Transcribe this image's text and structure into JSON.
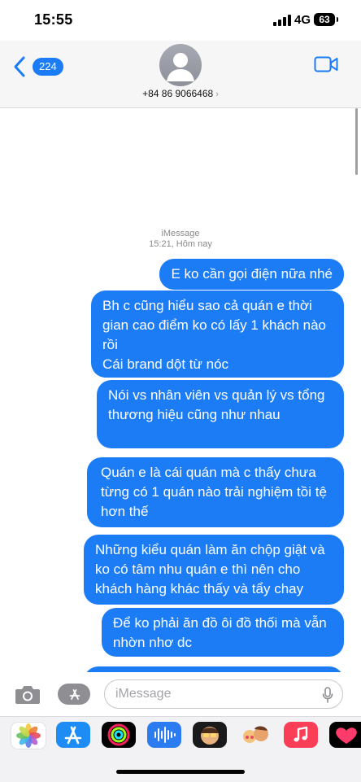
{
  "status_bar": {
    "time": "15:55",
    "network": "4G",
    "battery": "63"
  },
  "header": {
    "back_count": "224",
    "contact": "+84 86 9066468"
  },
  "thread": {
    "service": "iMessage",
    "timestamp": "15:21, Hôm nay",
    "messages": [
      "E ko cần gọi điện nữa nhé",
      "Bh c cũng hiểu sao cả quán e thời gian cao điểm ko có lấy 1 khách nào rồi\nCái brand dột từ nóc",
      "Nói vs nhân viên vs quản lý vs tổng thương hiệu cũng như nhau",
      "Quán e là cái quán mà c thấy chưa từng có 1 quán nào trải nghiệm tồi tệ hơn thế",
      "Những kiểu quán làm ăn chộp giật và ko có tâm nhu quán e thì nên cho khách hàng khác thấy và tẩy chay",
      "Để ko phải ăn đồ ôi đồ thối mà vẫn nhờn nhơ dc"
    ]
  },
  "input": {
    "placeholder": "iMessage",
    "value": ""
  },
  "app_drawer": {
    "apps": [
      "photos-app",
      "app-store-app",
      "fitness-app",
      "audio-message-app",
      "memoji-app",
      "memoji-stickers-app",
      "music-app",
      "digital-touch-app"
    ]
  },
  "colors": {
    "bubble": "#1b7cf5",
    "header_bg": "#f6f6f6",
    "drawer_bg": "#f2f2f4"
  }
}
